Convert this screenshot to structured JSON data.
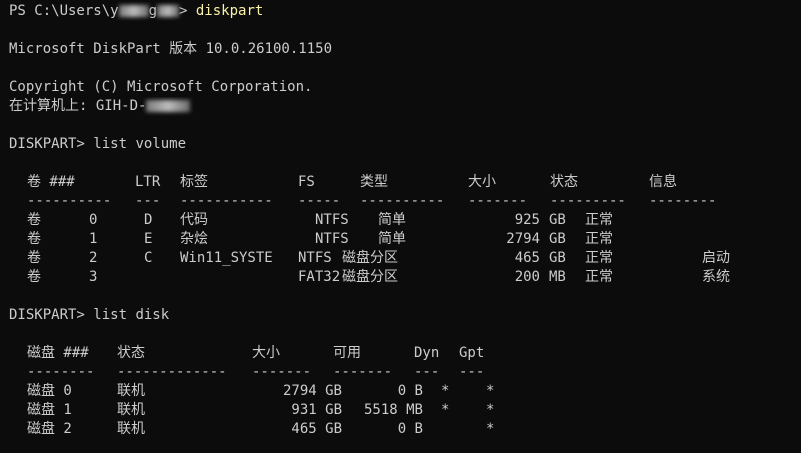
{
  "prompt": {
    "prefix": "PS C:\\Users\\y",
    "user_tail": "g",
    "suffix": "> ",
    "command": "diskpart"
  },
  "banner": {
    "version": "Microsoft DiskPart 版本 10.0.26100.1150",
    "copyright": "Copyright (C) Microsoft Corporation.",
    "computer": "在计算机上: GIH-D-"
  },
  "volume_cmd": {
    "prompt": "DISKPART> ",
    "command": "list volume"
  },
  "volume_table": {
    "headers": [
      "卷 ###",
      "LTR",
      "标签",
      "FS",
      "类型",
      "大小",
      "状态",
      "信息"
    ],
    "separators": [
      "----------",
      "---",
      "-----------",
      "-----",
      "----------",
      "-------",
      "---------",
      "--------"
    ],
    "rows": [
      [
        "卷",
        "0",
        "D",
        "代码",
        "NTFS",
        "简单",
        "925",
        "GB",
        "正常",
        ""
      ],
      [
        "卷",
        "1",
        "E",
        "杂烩",
        "NTFS",
        "简单",
        "2794",
        "GB",
        "正常",
        ""
      ],
      [
        "卷",
        "2",
        "C",
        "Win11_SYSTE",
        "NTFS",
        "磁盘分区",
        "465",
        "GB",
        "正常",
        "启动"
      ],
      [
        "卷",
        "3",
        "",
        "",
        "FAT32",
        "磁盘分区",
        "200",
        "MB",
        "正常",
        "系统"
      ]
    ]
  },
  "disk_cmd": {
    "prompt": "DISKPART> ",
    "command": "list disk"
  },
  "disk_table": {
    "headers": [
      "磁盘 ###",
      "状态",
      "大小",
      "可用",
      "Dyn",
      "Gpt"
    ],
    "separators": [
      "--------",
      "-------------",
      "-------",
      "-------",
      "---",
      "---"
    ],
    "rows": [
      [
        "磁盘 0",
        "联机",
        "2794 GB",
        "0 B",
        "*",
        "*"
      ],
      [
        "磁盘 1",
        "联机",
        "931 GB",
        "5518 MB",
        "*",
        "*"
      ],
      [
        "磁盘 2",
        "联机",
        "465 GB",
        "0 B",
        "",
        "*"
      ]
    ]
  },
  "colors": {
    "background": "#0c0c0c",
    "text": "#cccccc",
    "command": "#f9f1a5"
  }
}
